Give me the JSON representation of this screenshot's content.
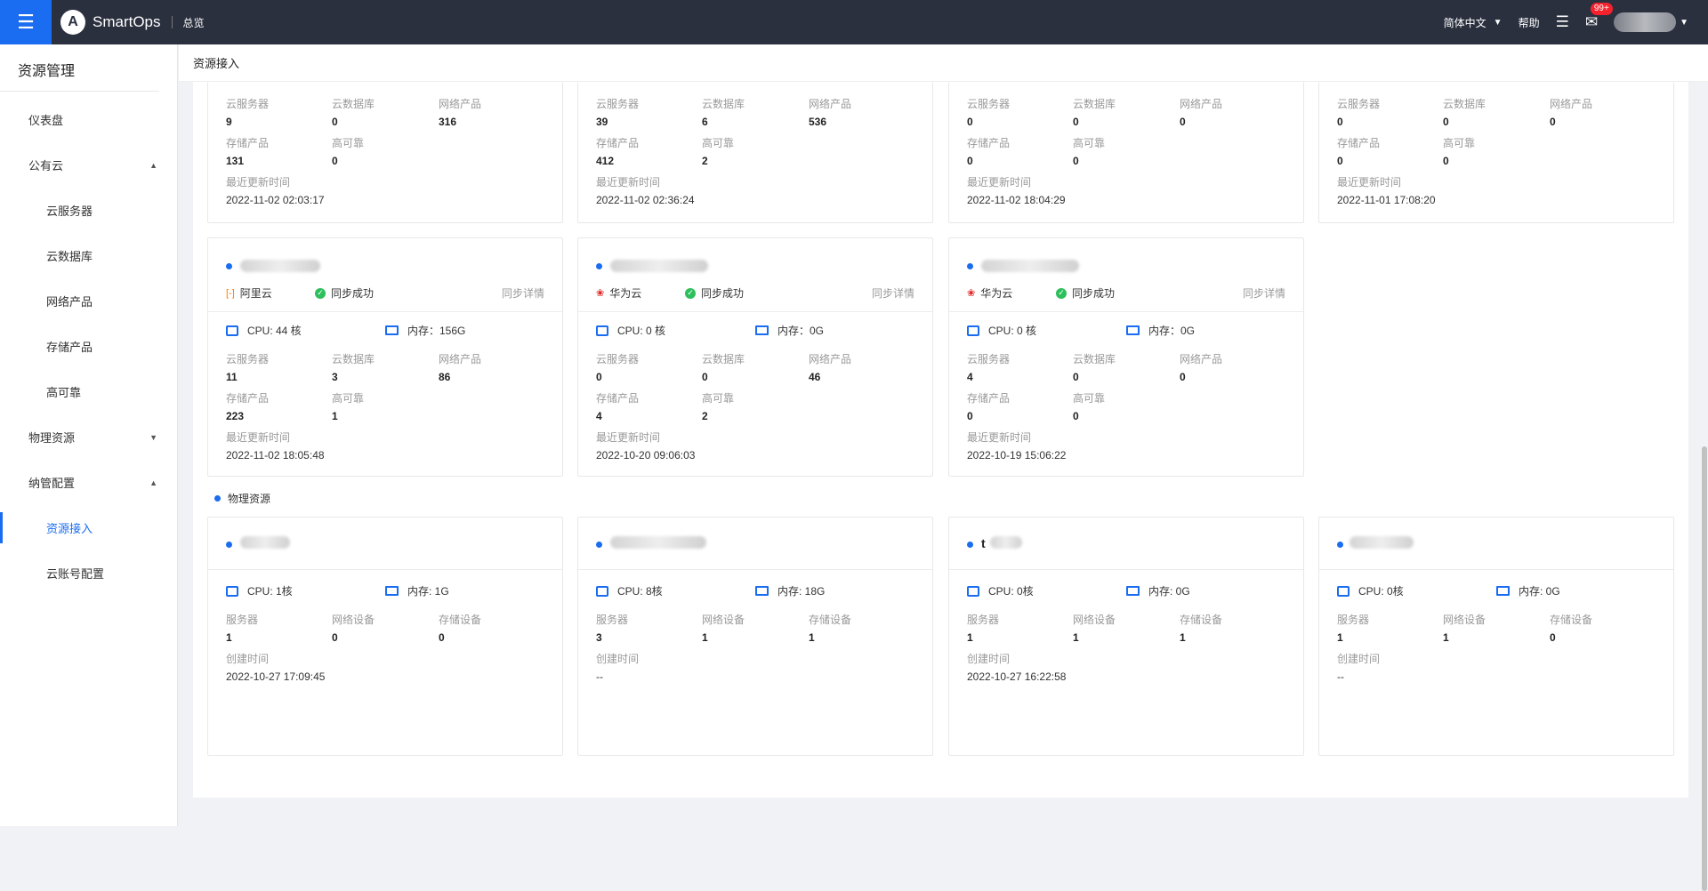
{
  "topbar": {
    "app_name": "SmartOps",
    "nav_overview": "总览",
    "language": "简体中文",
    "help": "帮助",
    "mail_badge": "99+"
  },
  "sidebar": {
    "title": "资源管理",
    "items": [
      {
        "label": "仪表盘",
        "level": 1
      },
      {
        "label": "公有云",
        "level": 1,
        "expanded": true
      },
      {
        "label": "云服务器",
        "level": 2
      },
      {
        "label": "云数据库",
        "level": 2
      },
      {
        "label": "网络产品",
        "level": 2
      },
      {
        "label": "存储产品",
        "level": 2
      },
      {
        "label": "高可靠",
        "level": 2
      },
      {
        "label": "物理资源",
        "level": 1,
        "expanded": false
      },
      {
        "label": "纳管配置",
        "level": 1,
        "expanded": true
      },
      {
        "label": "资源接入",
        "level": 2,
        "active": true
      },
      {
        "label": "云账号配置",
        "level": 2
      }
    ]
  },
  "page": {
    "subheader": "资源接入",
    "physical_section": "物理资源"
  },
  "labels": {
    "cloud_server": "云服务器",
    "cloud_db": "云数据库",
    "network": "网络产品",
    "storage": "存储产品",
    "ha": "高可靠",
    "last_update": "最近更新时间",
    "sync_detail": "同步详情",
    "server": "服务器",
    "net_device": "网络设备",
    "storage_device": "存储设备",
    "created_time": "创建时间"
  },
  "top_cards": [
    {
      "cloud_server": "9",
      "cloud_db": "0",
      "network": "316",
      "storage": "131",
      "ha": "0",
      "updated": "2022-11-02 02:03:17"
    },
    {
      "cloud_server": "39",
      "cloud_db": "6",
      "network": "536",
      "storage": "412",
      "ha": "2",
      "updated": "2022-11-02 02:36:24"
    },
    {
      "cloud_server": "0",
      "cloud_db": "0",
      "network": "0",
      "storage": "0",
      "ha": "0",
      "updated": "2022-11-02 18:04:29"
    },
    {
      "cloud_server": "0",
      "cloud_db": "0",
      "network": "0",
      "storage": "0",
      "ha": "0",
      "updated": "2022-11-01 17:08:20"
    }
  ],
  "cloud_cards": [
    {
      "provider": "阿里云",
      "provider_icon": "aliyun-icon",
      "status": "同步成功",
      "cpu": "CPU: 44 核",
      "mem": "内存：156G",
      "cloud_server": "11",
      "cloud_db": "3",
      "network": "86",
      "storage": "223",
      "ha": "1",
      "updated": "2022-11-02 18:05:48"
    },
    {
      "provider": "华为云",
      "provider_icon": "huawei-icon",
      "status": "同步成功",
      "cpu": "CPU: 0 核",
      "mem": "内存：0G",
      "cloud_server": "0",
      "cloud_db": "0",
      "network": "46",
      "storage": "4",
      "ha": "2",
      "updated": "2022-10-20 09:06:03"
    },
    {
      "provider": "华为云",
      "provider_icon": "huawei-icon",
      "status": "同步成功",
      "cpu": "CPU: 0 核",
      "mem": "内存：0G",
      "cloud_server": "4",
      "cloud_db": "0",
      "network": "0",
      "storage": "0",
      "ha": "0",
      "updated": "2022-10-19 15:06:22"
    }
  ],
  "physical_cards": [
    {
      "name_visible": "",
      "cpu": "CPU: 1核",
      "mem": "内存: 1G",
      "server": "1",
      "net_device": "0",
      "storage_device": "0",
      "created": "2022-10-27 17:09:45"
    },
    {
      "name_visible": "",
      "cpu": "CPU: 8核",
      "mem": "内存: 18G",
      "server": "3",
      "net_device": "1",
      "storage_device": "1",
      "created": "--"
    },
    {
      "name_visible": "t",
      "cpu": "CPU: 0核",
      "mem": "内存: 0G",
      "server": "1",
      "net_device": "1",
      "storage_device": "1",
      "created": "2022-10-27 16:22:58"
    },
    {
      "name_visible": "",
      "cpu": "CPU: 0核",
      "mem": "内存: 0G",
      "server": "1",
      "net_device": "1",
      "storage_device": "0",
      "created": "--"
    }
  ]
}
